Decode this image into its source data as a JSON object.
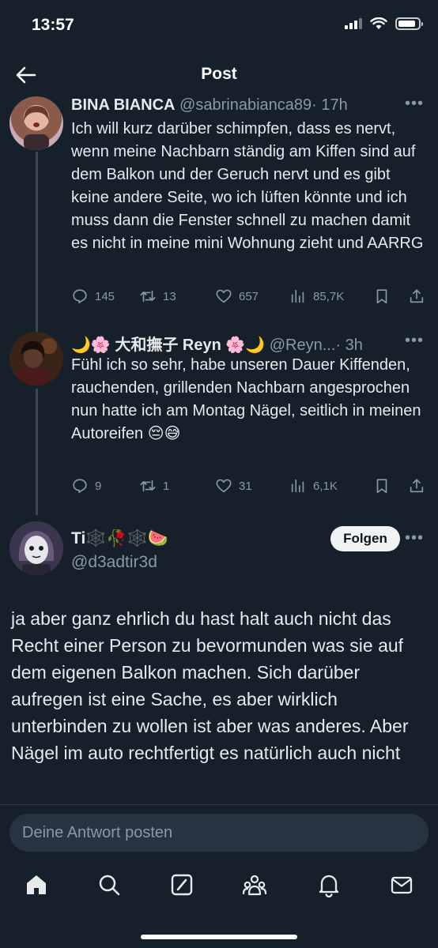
{
  "status_bar": {
    "time": "13:57"
  },
  "header": {
    "title": "Post"
  },
  "tweets": [
    {
      "name": "BINA BIANCA",
      "handle": "@sabrinabianca89",
      "time": "· 17h",
      "text": "Ich will kurz darüber schimpfen, dass es nervt, wenn meine Nachbarn ständig am Kiffen sind auf dem Balkon und der Geruch nervt und es gibt keine andere Seite, wo ich lüften könnte und ich muss dann die Fenster schnell zu machen damit es nicht in meine mini Wohnung zieht und AARRG",
      "replies": "145",
      "retweets": "13",
      "likes": "657",
      "views": "85,7K"
    },
    {
      "name": "🌙🌸 大和撫子 Reyn 🌸🌙",
      "handle": "@Reyn...",
      "time": "· 3h",
      "text": "Fühl ich so sehr, habe unseren Dauer Kiffenden, rauchenden, grillenden Nachbarn angesprochen nun hatte ich am Montag Nägel, seitlich in meinen Autoreifen 😔😅",
      "replies": "9",
      "retweets": "1",
      "likes": "31",
      "views": "6,1K"
    }
  ],
  "main_tweet": {
    "name": "Ti🕸️🥀🕸️🍉",
    "handle": "@d3adtir3d",
    "follow_label": "Folgen",
    "text": "ja aber ganz ehrlich du hast halt auch nicht das Recht einer Person zu bevormunden was sie auf dem eigenen Balkon machen. Sich darüber aufregen ist eine Sache, es aber wirklich unterbinden zu wollen ist aber was anderes. Aber Nägel im auto rechtfertigt es natürlich auch nicht"
  },
  "reply": {
    "placeholder": "Deine Antwort posten"
  },
  "tabs": [
    "home-icon",
    "search-icon",
    "grok-icon",
    "communities-icon",
    "notifications-icon",
    "messages-icon"
  ]
}
